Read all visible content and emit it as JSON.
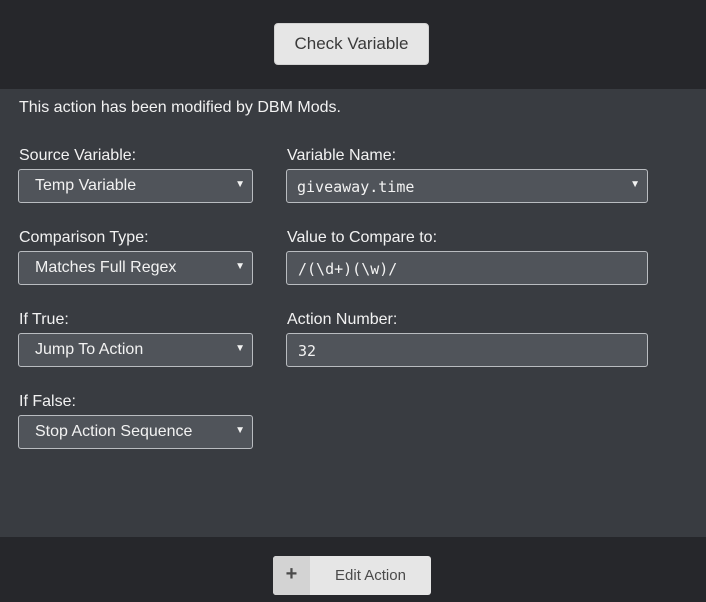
{
  "header": {
    "check_button_label": "Check Variable"
  },
  "panel": {
    "notice": "This action has been modified by DBM Mods.",
    "source_variable": {
      "label": "Source Variable:",
      "value": "Temp Variable"
    },
    "variable_name": {
      "label": "Variable Name:",
      "value": "giveaway.time"
    },
    "comparison_type": {
      "label": "Comparison Type:",
      "value": "Matches Full Regex"
    },
    "value_to_compare": {
      "label": "Value to Compare to:",
      "value": "/(\\d+)(\\w)/"
    },
    "if_true": {
      "label": "If True:",
      "value": "Jump To Action"
    },
    "action_number": {
      "label": "Action Number:",
      "value": "32"
    },
    "if_false": {
      "label": "If False:",
      "value": "Stop Action Sequence"
    },
    "dropdown_icon": "triangle-down-icon"
  },
  "footer": {
    "plus_icon": "+",
    "edit_button_label": "Edit Action"
  }
}
